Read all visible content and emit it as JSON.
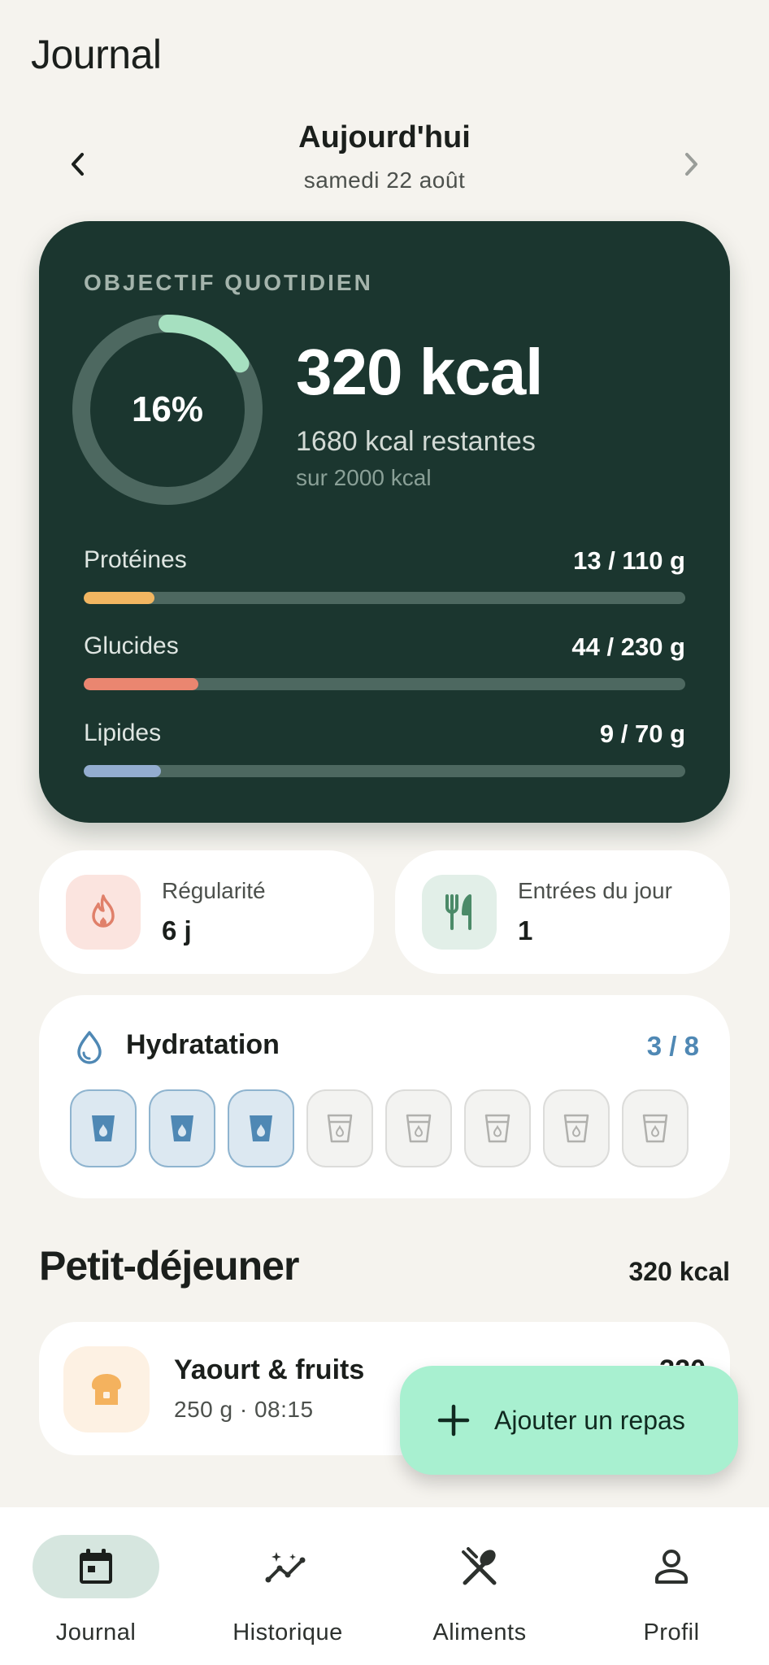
{
  "header": {
    "title": "Journal",
    "date_title": "Aujourd'hui",
    "date_subtitle": "samedi 22 août"
  },
  "goal": {
    "label": "OBJECTIF QUOTIDIEN",
    "percent": 16,
    "percent_label": "16%",
    "kcal_consumed": "320 kcal",
    "kcal_remaining": "1680 kcal restantes",
    "kcal_target": "sur 2000 kcal",
    "macros": [
      {
        "name": "Protéines",
        "value": "13 / 110 g",
        "progress": 0.118,
        "color": "#f2b661"
      },
      {
        "name": "Glucides",
        "value": "44 / 230 g",
        "progress": 0.191,
        "color": "#ea8670"
      },
      {
        "name": "Lipides",
        "value": "9 / 70 g",
        "progress": 0.129,
        "color": "#93add0"
      }
    ]
  },
  "stats": {
    "streak_label": "Régularité",
    "streak_value": "6 j",
    "entries_label": "Entrées du jour",
    "entries_value": "1"
  },
  "hydration": {
    "title": "Hydratation",
    "count": "3 / 8",
    "filled": 3,
    "total": 8
  },
  "meal": {
    "section_title": "Petit-déjeuner",
    "section_kcal": "320 kcal",
    "entry_name": "Yaourt & fruits",
    "entry_meta": "250 g · 08:15",
    "entry_kcal": "320"
  },
  "fab": {
    "label": "Ajouter un repas"
  },
  "nav": [
    {
      "label": "Journal",
      "icon": "calendar-icon",
      "active": true
    },
    {
      "label": "Historique",
      "icon": "insights-icon",
      "active": false
    },
    {
      "label": "Aliments",
      "icon": "utensils-icon",
      "active": false
    },
    {
      "label": "Profil",
      "icon": "person-icon",
      "active": false
    }
  ],
  "colors": {
    "card_dark": "#1b362f",
    "ring_accent": "#a6e0c0",
    "water": "#4f88b4",
    "fab": "#a8f0d0"
  }
}
